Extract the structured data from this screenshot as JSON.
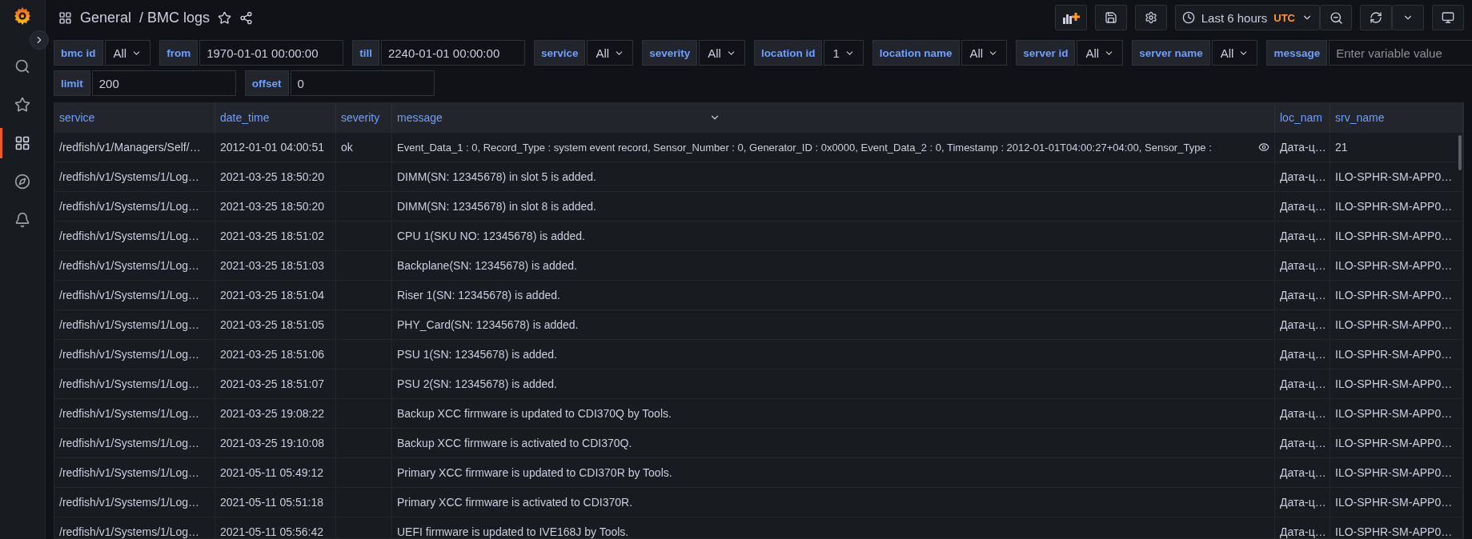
{
  "breadcrumb": {
    "folder": "General",
    "title": "/ BMC logs"
  },
  "time_picker": {
    "label": "Last 6 hours",
    "zone": "UTC"
  },
  "variable_rows": [
    [
      {
        "label": "bmc id",
        "kind": "select",
        "value": "All"
      },
      {
        "label": "from",
        "kind": "text",
        "value": "1970-01-01 00:00:00"
      },
      {
        "label": "till",
        "kind": "text",
        "value": "2240-01-01 00:00:00"
      },
      {
        "label": "service",
        "kind": "select",
        "value": "All"
      },
      {
        "label": "severity",
        "kind": "select",
        "value": "All"
      },
      {
        "label": "location id",
        "kind": "select",
        "value": "1"
      },
      {
        "label": "location name",
        "kind": "select",
        "value": "All"
      },
      {
        "label": "server id",
        "kind": "select",
        "value": "All"
      },
      {
        "label": "server name",
        "kind": "select",
        "value": "All"
      },
      {
        "label": "message",
        "kind": "text",
        "placeholder": "Enter variable value"
      }
    ],
    [
      {
        "label": "limit",
        "kind": "text",
        "value": "200"
      },
      {
        "label": "offset",
        "kind": "text",
        "value": "0"
      }
    ]
  ],
  "table": {
    "columns": [
      "service",
      "date_time",
      "severity",
      "message",
      "loc_nam",
      "srv_name"
    ],
    "rows": [
      {
        "service": "/redfish/v1/Managers/Self/…",
        "date_time": "2012-01-01 04:00:51",
        "severity": "ok",
        "message": "Event_Data_1 : 0, Record_Type : system event record, Sensor_Number : 0, Generator_ID : 0x0000, Event_Data_2 : 0, Timestamp : 2012-01-01T04:00:27+04:00, Sensor_Type :",
        "loc_name": "Дата-ц…",
        "srv_name": "21"
      },
      {
        "service": "/redfish/v1/Systems/1/Log…",
        "date_time": "2021-03-25 18:50:20",
        "message": "DIMM(SN: 12345678) in slot 5 is added.",
        "loc_name": "Дата-ц…",
        "srv_name": "ILO-SPHR-SM-APP0…"
      },
      {
        "service": "/redfish/v1/Systems/1/Log…",
        "date_time": "2021-03-25 18:50:20",
        "message": "DIMM(SN: 12345678) in slot 8 is added.",
        "loc_name": "Дата-ц…",
        "srv_name": "ILO-SPHR-SM-APP0…"
      },
      {
        "service": "/redfish/v1/Systems/1/Log…",
        "date_time": "2021-03-25 18:51:02",
        "message": "CPU 1(SKU NO: 12345678) is added.",
        "loc_name": "Дата-ц…",
        "srv_name": "ILO-SPHR-SM-APP0…"
      },
      {
        "service": "/redfish/v1/Systems/1/Log…",
        "date_time": "2021-03-25 18:51:03",
        "message": "Backplane(SN: 12345678) is added.",
        "loc_name": "Дата-ц…",
        "srv_name": "ILO-SPHR-SM-APP0…"
      },
      {
        "service": "/redfish/v1/Systems/1/Log…",
        "date_time": "2021-03-25 18:51:04",
        "message": "Riser 1(SN: 12345678) is added.",
        "loc_name": "Дата-ц…",
        "srv_name": "ILO-SPHR-SM-APP0…"
      },
      {
        "service": "/redfish/v1/Systems/1/Log…",
        "date_time": "2021-03-25 18:51:05",
        "message": "PHY_Card(SN: 12345678) is added.",
        "loc_name": "Дата-ц…",
        "srv_name": "ILO-SPHR-SM-APP0…"
      },
      {
        "service": "/redfish/v1/Systems/1/Log…",
        "date_time": "2021-03-25 18:51:06",
        "message": "PSU 1(SN: 12345678) is added.",
        "loc_name": "Дата-ц…",
        "srv_name": "ILO-SPHR-SM-APP0…"
      },
      {
        "service": "/redfish/v1/Systems/1/Log…",
        "date_time": "2021-03-25 18:51:07",
        "message": "PSU 2(SN: 12345678) is added.",
        "loc_name": "Дата-ц…",
        "srv_name": "ILO-SPHR-SM-APP0…"
      },
      {
        "service": "/redfish/v1/Systems/1/Log…",
        "date_time": "2021-03-25 19:08:22",
        "message": "Backup XCC firmware is updated to CDI370Q by Tools.",
        "loc_name": "Дата-ц…",
        "srv_name": "ILO-SPHR-SM-APP0…"
      },
      {
        "service": "/redfish/v1/Systems/1/Log…",
        "date_time": "2021-03-25 19:10:08",
        "message": "Backup XCC firmware is activated to CDI370Q.",
        "loc_name": "Дата-ц…",
        "srv_name": "ILO-SPHR-SM-APP0…"
      },
      {
        "service": "/redfish/v1/Systems/1/Log…",
        "date_time": "2021-05-11 05:49:12",
        "message": "Primary XCC firmware is updated to CDI370R by Tools.",
        "loc_name": "Дата-ц…",
        "srv_name": "ILO-SPHR-SM-APP0…"
      },
      {
        "service": "/redfish/v1/Systems/1/Log…",
        "date_time": "2021-05-11 05:51:18",
        "message": "Primary XCC firmware is activated to CDI370R.",
        "loc_name": "Дата-ц…",
        "srv_name": "ILO-SPHR-SM-APP0…"
      },
      {
        "service": "/redfish/v1/Systems/1/Log…",
        "date_time": "2021-05-11 05:56:42",
        "message": "UEFI firmware is updated to IVE168J by Tools.",
        "loc_name": "Дата-ц…",
        "srv_name": "ILO-SPHR-SM-APP0…"
      }
    ]
  },
  "sidebar": {
    "items": [
      {
        "selected": false
      },
      {
        "selected": false
      },
      {
        "selected": true
      },
      {
        "selected": false
      },
      {
        "selected": false
      }
    ]
  }
}
